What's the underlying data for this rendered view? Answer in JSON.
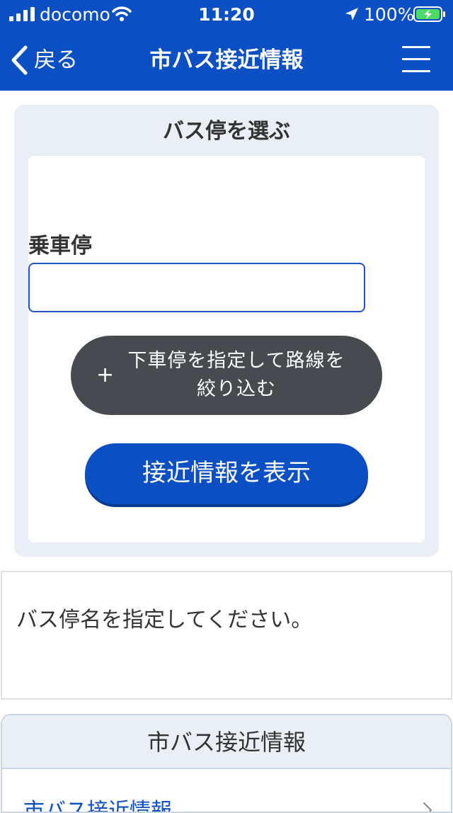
{
  "status_bar": {
    "carrier": "docomo",
    "time": "11:20",
    "battery_percent": "100%"
  },
  "nav": {
    "back_label": "戻る",
    "title": "市バス接近情報"
  },
  "search_panel": {
    "title": "バス停を選ぶ",
    "boarding_label": "乗車停",
    "boarding_value": "",
    "filter_button_label": "下車停を指定して路線を絞り込む",
    "filter_button_line1": "下車停を指定して路線を",
    "filter_button_line2": "絞り込む",
    "filter_icon": "+",
    "show_button_label": "接近情報を表示"
  },
  "message": {
    "text": "バス停名を指定してください。"
  },
  "links": {
    "header": "市バス接近情報",
    "items": [
      {
        "label": "市バス接近情報"
      }
    ]
  },
  "colors": {
    "brand_blue": "#0a4fc4",
    "filter_button": "#474a4f",
    "panel_background": "#eaeff6",
    "battery_green": "#4cd964"
  }
}
